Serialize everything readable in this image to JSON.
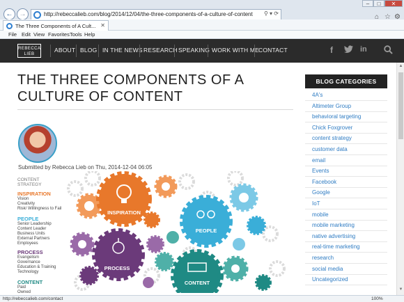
{
  "browser": {
    "address_url": "http://rebeccalieb.com/blog/2014/12/04/the-three-components-of-a-culture-of-content",
    "tab_title": "The Three Components of A Cult...",
    "menu": [
      "File",
      "Edit",
      "View",
      "Favorites",
      "Tools",
      "Help"
    ],
    "status_url": "http://rebeccalieb.com/contact",
    "zoom": "100%"
  },
  "site": {
    "logo_line1": "REBECCA",
    "logo_line2": "LIEB",
    "nav": [
      "ABOUT",
      "BLOG",
      "IN THE NEWS",
      "RESEARCH",
      "SPEAKING",
      "WORK WITH ME",
      "CONTACT"
    ],
    "social_icons": [
      "facebook-icon",
      "twitter-icon",
      "linkedin-icon",
      "search-icon"
    ]
  },
  "post": {
    "title": "THE THREE COMPONENTS OF A CULTURE OF CONTENT",
    "submitted": "Submitted by Rebecca Lieb on Thu, 2014-12-04 06:05"
  },
  "infographic": {
    "heading": "CONTENT STRATEGY",
    "sections": [
      {
        "title": "INSPIRATION",
        "color": "#e8782b",
        "items": [
          "Vision",
          "Creativity",
          "Risk/ Willingness to Fail"
        ]
      },
      {
        "title": "PEOPLE",
        "color": "#3aaed8",
        "items": [
          "Senior Leadership",
          "Content Leader",
          "Business Units",
          "External Partners",
          "Employees"
        ]
      },
      {
        "title": "PROCESS",
        "color": "#6b3a7a",
        "items": [
          "Evangelism",
          "Governance",
          "Education & Training",
          "Technology"
        ]
      },
      {
        "title": "CONTENT",
        "color": "#1f8a84",
        "items": [
          "Paid",
          "Owned"
        ]
      }
    ],
    "gear_labels": [
      "INSPIRATION",
      "PEOPLE",
      "PROCESS",
      "CONTENT"
    ]
  },
  "sidebar": {
    "heading": "BLOG CATEGORIES",
    "categories": [
      "4A's",
      "Altimeter Group",
      "behavioral targeting",
      "Chick Foxgrover",
      "content strategy",
      "customer data",
      "email",
      "Events",
      "Facebook",
      "Google",
      "IoT",
      "mobile",
      "mobile marketing",
      "native advertising",
      "real-time marketing",
      "research",
      "social media",
      "Uncategorized"
    ]
  },
  "colors": {
    "header_bg": "#2b2b2b",
    "link": "#2f7cc3",
    "inspiration": "#e8782b",
    "people": "#3aaed8",
    "process": "#6b3a7a",
    "content": "#1f8a84"
  }
}
